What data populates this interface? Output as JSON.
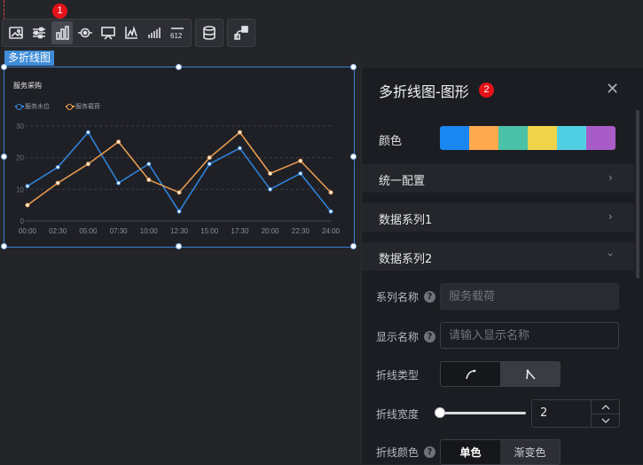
{
  "annotations": {
    "badge1": "1",
    "badge2": "2"
  },
  "toolbar": {
    "group1": [
      "image-icon",
      "sliders-icon",
      "bar-chart-icon",
      "target-icon",
      "screen-icon",
      "signal-icon",
      "bars-icon",
      "number-612-icon"
    ],
    "number_label": "612",
    "group2": [
      "database-icon"
    ],
    "group3": [
      "share-icon"
    ]
  },
  "component": {
    "label": "多折线图"
  },
  "chart_data": {
    "type": "line",
    "title": "服务采购",
    "categories": [
      "00:00",
      "02:30",
      "05:00",
      "07:30",
      "10:00",
      "12:30",
      "15:00",
      "17:30",
      "20:00",
      "22:30",
      "24:00"
    ],
    "ylim": [
      0,
      30
    ],
    "yticks": [
      "0",
      "10",
      "20",
      "30"
    ],
    "grid": true,
    "legend_position": "top-left",
    "series": [
      {
        "name": "服务水位",
        "color": "#2f86e0",
        "values": [
          11,
          17,
          28,
          12,
          18,
          3,
          18,
          23,
          10,
          15,
          3
        ]
      },
      {
        "name": "服务载荷",
        "color": "#f0a04f",
        "values": [
          5,
          12,
          18,
          25,
          13,
          9,
          20,
          28,
          15,
          19,
          9
        ]
      }
    ]
  },
  "panel": {
    "title": "多折线图-图形",
    "color_label": "颜色",
    "palette": [
      "#1a86f1",
      "#ffaa4e",
      "#4bc2a8",
      "#f0d44a",
      "#52d0e3",
      "#a85cc7"
    ],
    "sections": [
      {
        "label": "统一配置",
        "state": "collapsed"
      },
      {
        "label": "数据系列1",
        "state": "collapsed"
      },
      {
        "label": "数据系列2",
        "state": "expanded"
      }
    ],
    "series_name_label": "系列名称",
    "series_name_value": "服务载荷",
    "display_name_label": "显示名称",
    "display_name_placeholder": "请输入显示名称",
    "line_type_label": "折线类型",
    "line_type_options": [
      "curve-icon",
      "polyline-icon"
    ],
    "line_width_label": "折线宽度",
    "line_width_value": "2",
    "line_color_label": "折线颜色",
    "line_color_options": [
      "单色",
      "渐变色"
    ],
    "line_color_selected": "单色"
  }
}
